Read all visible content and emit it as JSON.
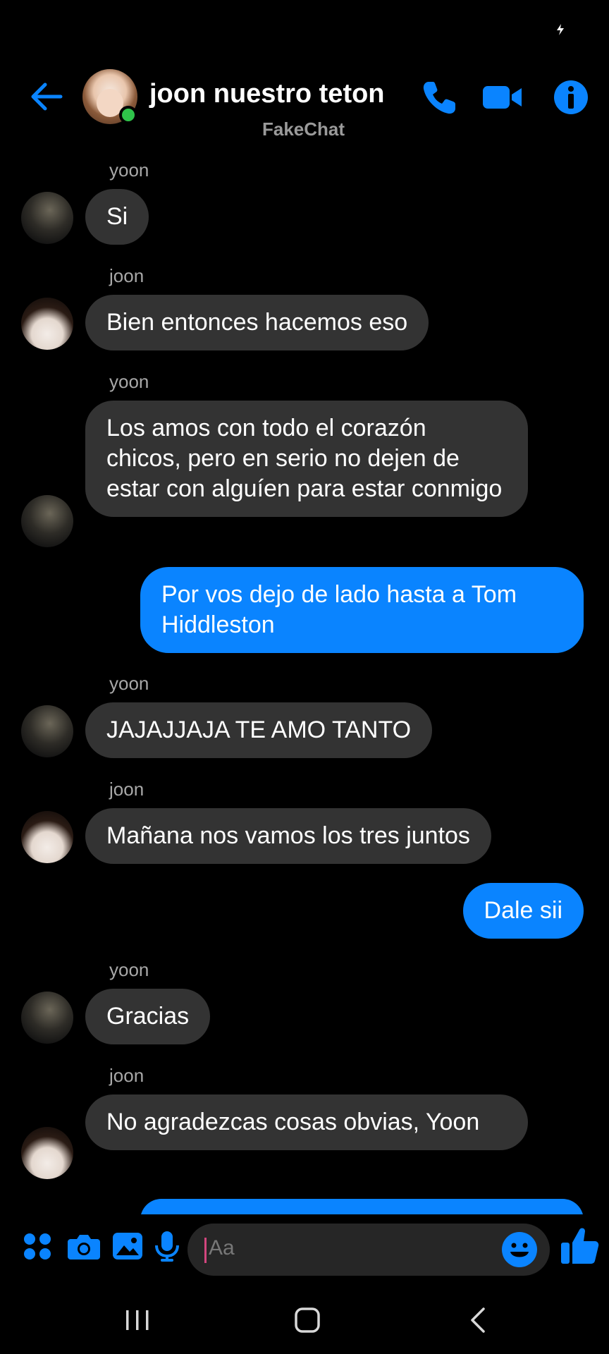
{
  "status_bar": {
    "charging_icon": "charging-bolt-icon"
  },
  "header": {
    "title": "joon nuestro teton",
    "subtitle": "FakeChat",
    "icons": [
      "back-arrow-icon",
      "phone-icon",
      "video-camera-icon",
      "info-icon"
    ],
    "accent_color": "#0a84ff",
    "online_color": "#2fc34a"
  },
  "messages": [
    {
      "author": "yoon",
      "text": "Si",
      "side": "in"
    },
    {
      "author": "joon",
      "text": "Bien entonces hacemos eso",
      "side": "in"
    },
    {
      "author": "yoon",
      "text": "Los amos con todo el corazón chicos, pero en serio no dejen de estar con alguíen para estar conmigo",
      "side": "in"
    },
    {
      "author": "",
      "text": "Por vos dejo de lado hasta a Tom Hiddleston",
      "side": "out"
    },
    {
      "author": "yoon",
      "text": "JAJAJJAJA TE AMO TANTO",
      "side": "in"
    },
    {
      "author": "joon",
      "text": "Mañana nos vamos los tres juntos",
      "side": "in"
    },
    {
      "author": "",
      "text": "Dale sii",
      "side": "out"
    },
    {
      "author": "yoon",
      "text": "Gracias",
      "side": "in"
    },
    {
      "author": "joon",
      "text": "No agradezcas cosas obvias, Yoon",
      "side": "in"
    }
  ],
  "composer": {
    "placeholder": "Aa",
    "icons": [
      "apps-grid-icon",
      "camera-icon",
      "gallery-icon",
      "microphone-icon",
      "emoji-icon",
      "thumbs-up-icon"
    ]
  },
  "navbar": {
    "icons": [
      "recent-apps-icon",
      "home-icon",
      "back-icon"
    ]
  },
  "colors": {
    "background": "#000000",
    "incoming_bubble": "#333333",
    "outgoing_bubble": "#0a84ff"
  }
}
